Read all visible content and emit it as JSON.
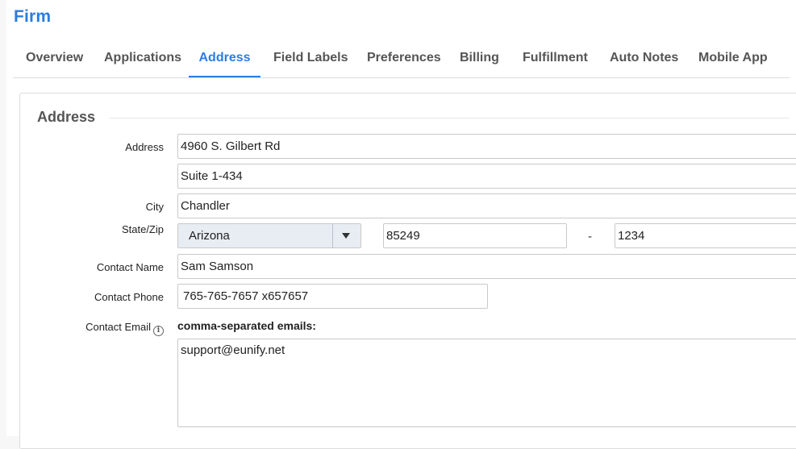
{
  "page": {
    "title": "Firm"
  },
  "tabs": [
    {
      "label": "Overview",
      "active": false
    },
    {
      "label": "Applications",
      "active": false
    },
    {
      "label": "Address",
      "active": true
    },
    {
      "label": "Field Labels",
      "active": false
    },
    {
      "label": "Preferences",
      "active": false
    },
    {
      "label": "Billing",
      "active": false
    },
    {
      "label": "Fulfillment",
      "active": false
    },
    {
      "label": "Auto Notes",
      "active": false
    },
    {
      "label": "Mobile App",
      "active": false
    }
  ],
  "colors": {
    "accent": "#2a7de1",
    "select_bg": "#e8edf3"
  },
  "section": {
    "title": "Address"
  },
  "form": {
    "address": {
      "label": "Address",
      "line1": "4960 S. Gilbert Rd",
      "line2": "Suite 1-434"
    },
    "city": {
      "label": "City",
      "value": "Chandler"
    },
    "state_zip": {
      "label": "State/Zip",
      "state": "Arizona",
      "zip": "85249",
      "separator": "-",
      "zip_ext": "1234"
    },
    "contact_name": {
      "label": "Contact Name",
      "value": "Sam Samson"
    },
    "contact_phone": {
      "label": "Contact Phone",
      "value": "765-765-7657 x657657"
    },
    "contact_email": {
      "label": "Contact Email",
      "info_icon": "info-icon",
      "hint": "comma-separated emails:",
      "value": "support@eunify.net"
    }
  }
}
